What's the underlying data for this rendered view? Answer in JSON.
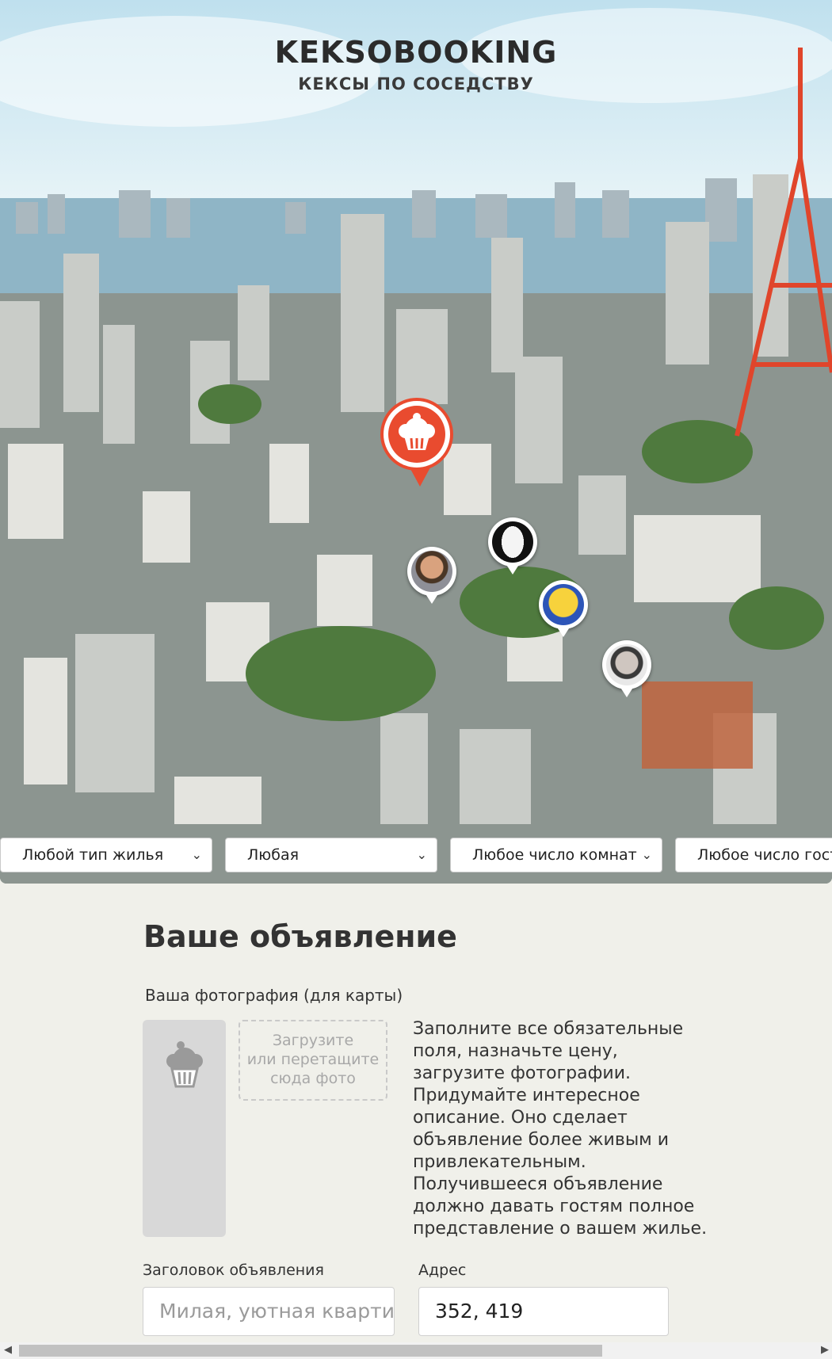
{
  "brand": {
    "title": "KEKSOBOOKING",
    "subtitle": "КЕКСЫ ПО СОСЕДСТВУ"
  },
  "map": {
    "pins": [
      {
        "name": "main-pin",
        "icon": "muffin-icon",
        "color": "#e94b2f"
      },
      {
        "name": "pin-man-1",
        "icon": "avatar-man-icon"
      },
      {
        "name": "pin-mask",
        "icon": "avatar-mask-icon"
      },
      {
        "name": "pin-cartoon",
        "icon": "avatar-cartoon-icon"
      },
      {
        "name": "pin-man-2",
        "icon": "avatar-man-icon"
      }
    ]
  },
  "filters": [
    {
      "label": "Любой тип жилья"
    },
    {
      "label": "Любая"
    },
    {
      "label": "Любое число комнат"
    },
    {
      "label": "Любое число гостей"
    }
  ],
  "form": {
    "title": "Ваше объявление",
    "avatar_label": "Ваша фотография (для карты)",
    "upload_text": [
      "Загрузите",
      "или перетащите",
      "сюда фото"
    ],
    "hint": "Заполните все обязательные поля, назначьте цену, загрузите фотографии. Придумайте интересное описание. Оно сделает объявление более живым и привлекательным. Получившееся объявление должно давать гостям полное представление о вашем жилье.",
    "title_label": "Заголовок объявления",
    "title_placeholder": "Милая, уютная квартирка в центре Токио",
    "address_label": "Адрес",
    "address_value": "352, 419"
  },
  "colors": {
    "accent": "#e94b2f",
    "page_bg": "#f0f0ea"
  }
}
